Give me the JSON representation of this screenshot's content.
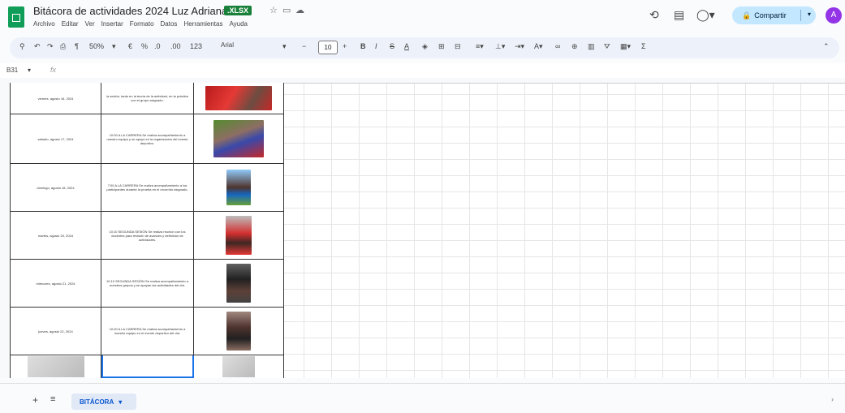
{
  "header": {
    "title": "Bitácora de actividades 2024 Luz Adriana",
    "file_badge": ".XLSX",
    "menu": [
      "Archivo",
      "Editar",
      "Ver",
      "Insertar",
      "Formato",
      "Datos",
      "Herramientas",
      "Ayuda"
    ],
    "share_label": "Compartir",
    "avatar_initial": "A"
  },
  "toolbar": {
    "zoom": "50%",
    "font": "Arial",
    "font_size": "10"
  },
  "formula_bar": {
    "cell_ref": "B31",
    "fx": "fx"
  },
  "rows": [
    {
      "date": "viernes, agosto 16, 2024",
      "activity": "la sesión, tanto en la teoría de la actividad, en la práctica con el grupo asignado."
    },
    {
      "date": "sábado, agosto 17, 2024",
      "activity": "10:00 A LA CARRERA Se realiza acompañamiento a nuestro equipo y se apoyó en la organización del evento deportivo."
    },
    {
      "date": "domingo, agosto 18, 2024",
      "activity": "7:00 A LA CARRERA Se realiza acompañamiento a los participantes durante la prueba en el recorrido asignado."
    },
    {
      "date": "martes, agosto 20, 2024",
      "activity": "10:10 SEGUNDA SESIÓN Se realiza reunión con los docentes para revisión de avances y definición de actividades."
    },
    {
      "date": "miércoles, agosto 21, 2024",
      "activity": "10:10 SEGUNDA SESIÓN Se realiza acompañamiento a nuestros grupos y se apoyan las actividades del día."
    },
    {
      "date": "jueves, agosto 22, 2024",
      "activity": "10:00 A LA CARRERA Se realiza acompañamiento a nuestro equipo en el evento deportivo del día."
    }
  ],
  "sheet_tab": "BITÁCORA",
  "colors": {
    "share_bg": "#c2e7ff",
    "brand_green": "#0f9d58",
    "avatar": "#9334e6"
  }
}
